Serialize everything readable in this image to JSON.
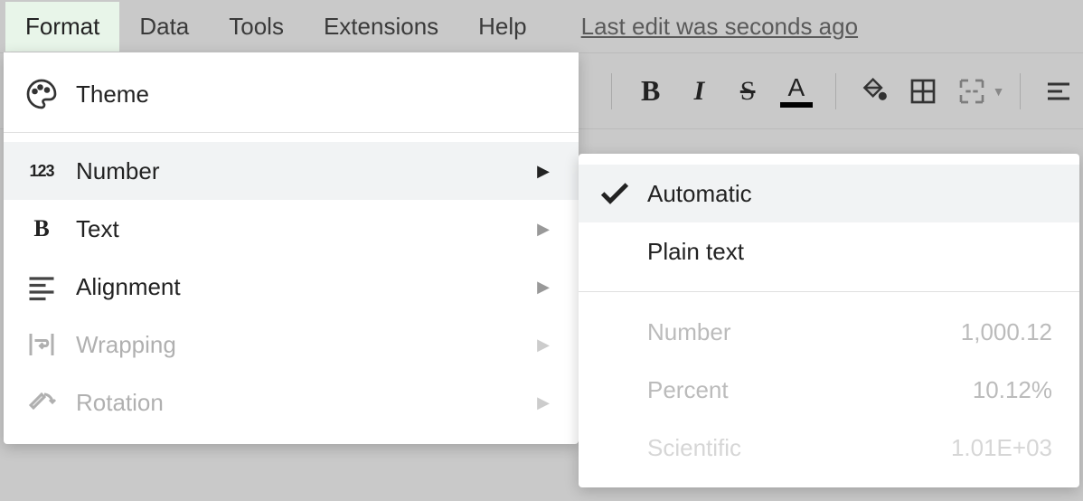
{
  "menubar": {
    "items": [
      {
        "label": "Format",
        "active": true
      },
      {
        "label": "Data",
        "active": false
      },
      {
        "label": "Tools",
        "active": false
      },
      {
        "label": "Extensions",
        "active": false
      },
      {
        "label": "Help",
        "active": false
      }
    ],
    "last_edit": "Last edit was seconds ago"
  },
  "toolbar": {
    "bold": "B",
    "italic": "I",
    "strike": "S",
    "text_color": "A"
  },
  "format_menu": {
    "theme": "Theme",
    "number": "Number",
    "text": "Text",
    "alignment": "Alignment",
    "wrapping": "Wrapping",
    "rotation": "Rotation"
  },
  "number_submenu": {
    "automatic": "Automatic",
    "plain_text": "Plain text",
    "number": {
      "label": "Number",
      "example": "1,000.12"
    },
    "percent": {
      "label": "Percent",
      "example": "10.12%"
    },
    "scientific": {
      "label": "Scientific",
      "example": "1.01E+03"
    }
  }
}
